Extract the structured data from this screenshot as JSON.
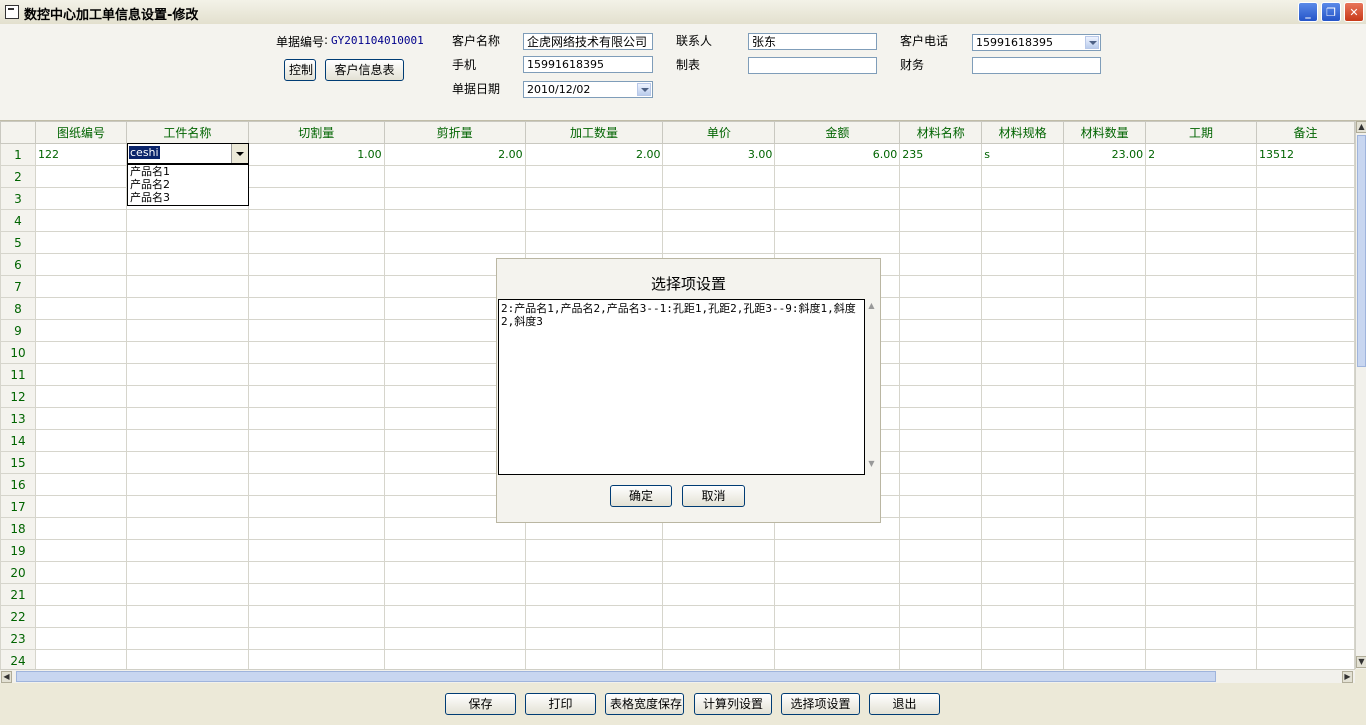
{
  "window": {
    "title": "数控中心加工单信息设置-修改",
    "min_label": "_",
    "max_label": "❐",
    "close_label": "✕"
  },
  "header": {
    "doc_no_label": "单据编号",
    "doc_no_value": "GY201104010001",
    "control_button": "控制",
    "customer_info_button": "客户信息表",
    "customer_name_label": "客户名称",
    "customer_name_value": "企虎网络技术有限公司",
    "mobile_label": "手机",
    "mobile_value": "15991618395",
    "date_label": "单据日期",
    "date_value": "2010/12/02",
    "contact_label": "联系人",
    "contact_value": "张东",
    "maker_label": "制表",
    "maker_value": "",
    "phone_label": "客户电话",
    "phone_value": "15991618395",
    "finance_label": "财务",
    "finance_value": ""
  },
  "grid": {
    "columns": [
      "图纸编号",
      "工件名称",
      "切割量",
      "剪折量",
      "加工数量",
      "单价",
      "金额",
      "材料名称",
      "材料规格",
      "材料数量",
      "工期",
      "备注"
    ],
    "rows": [
      [
        "122",
        "",
        "1.00",
        "2.00",
        "2.00",
        "3.00",
        "6.00",
        "235",
        "s",
        "23.00",
        "2",
        "13512"
      ]
    ],
    "row_numbers": [
      "1",
      "2",
      "3",
      "4",
      "5",
      "6",
      "7",
      "8",
      "9",
      "10",
      "11",
      "12",
      "13",
      "14",
      "15",
      "16",
      "17",
      "18",
      "19",
      "20",
      "21",
      "22",
      "23",
      "24"
    ]
  },
  "cell_editor": {
    "value": "ceshi",
    "options": [
      "产品名1",
      "产品名2",
      "产品名3"
    ]
  },
  "dialog": {
    "title": "选择项设置",
    "text": "2:产品名1,产品名2,产品名3--1:孔距1,孔距2,孔距3--9:斜度1,斜度2,斜度3",
    "ok": "确定",
    "cancel": "取消"
  },
  "toolbar": {
    "save": "保存",
    "print": "打印",
    "save_width": "表格宽度保存",
    "calc_settings": "计算列设置",
    "option_settings": "选择项设置",
    "exit": "退出"
  }
}
